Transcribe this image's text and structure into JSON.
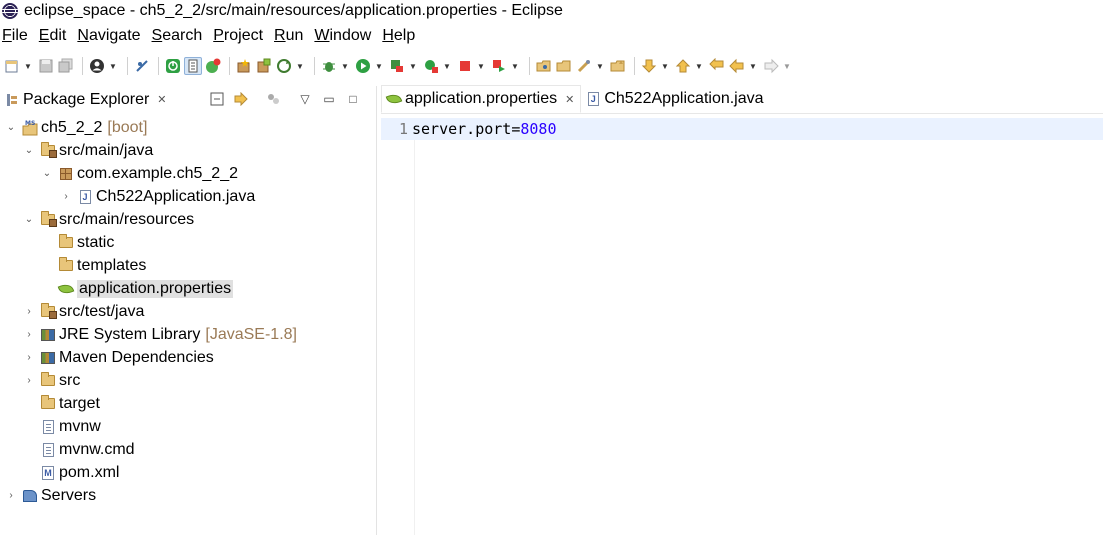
{
  "window": {
    "title": "eclipse_space - ch5_2_2/src/main/resources/application.properties - Eclipse"
  },
  "menu": [
    {
      "mnemonic": "F",
      "rest": "ile"
    },
    {
      "mnemonic": "E",
      "rest": "dit"
    },
    {
      "mnemonic": "N",
      "rest": "avigate"
    },
    {
      "mnemonic": "S",
      "rest": "earch"
    },
    {
      "mnemonic": "P",
      "rest": "roject"
    },
    {
      "mnemonic": "R",
      "rest": "un"
    },
    {
      "mnemonic": "W",
      "rest": "indow"
    },
    {
      "mnemonic": "H",
      "rest": "elp"
    }
  ],
  "explorer": {
    "title": "Package Explorer",
    "close": "✕",
    "tree": {
      "project": {
        "name": "ch5_2_2",
        "decoration": "[boot]",
        "icon_label": "M S"
      },
      "main_java": {
        "label": "src/main/java"
      },
      "package": {
        "label": "com.example.ch5_2_2"
      },
      "app_class": {
        "label": "Ch522Application.java"
      },
      "main_resources": {
        "label": "src/main/resources"
      },
      "static": {
        "label": "static"
      },
      "templates": {
        "label": "templates"
      },
      "app_props": {
        "label": "application.properties"
      },
      "test_java": {
        "label": "src/test/java"
      },
      "jre": {
        "label": "JRE System Library",
        "decoration": "[JavaSE-1.8]"
      },
      "maven": {
        "label": "Maven Dependencies"
      },
      "src": {
        "label": "src"
      },
      "target": {
        "label": "target"
      },
      "mvnw": {
        "label": "mvnw"
      },
      "mvnw_cmd": {
        "label": "mvnw.cmd"
      },
      "pom": {
        "label": "pom.xml"
      },
      "servers": {
        "label": "Servers"
      }
    }
  },
  "editor": {
    "tabs": [
      {
        "label": "application.properties",
        "close": "✕"
      },
      {
        "label": "Ch522Application.java"
      }
    ],
    "lines": [
      {
        "number": "1",
        "key": "server.port=",
        "value": "8080"
      }
    ]
  },
  "colors": {
    "selection": "#e0e0e0",
    "current_line": "#eaf2ff",
    "number_literal": "#2a00ff",
    "decoration": "#9a7a56"
  }
}
